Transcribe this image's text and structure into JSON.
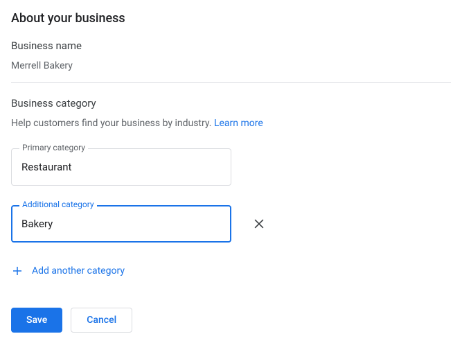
{
  "pageTitle": "About your business",
  "businessName": {
    "label": "Business name",
    "value": "Merrell Bakery"
  },
  "businessCategory": {
    "label": "Business category",
    "helperText": "Help customers find your business by industry. ",
    "learnMore": "Learn more"
  },
  "primaryCategory": {
    "label": "Primary category",
    "value": "Restaurant"
  },
  "additionalCategory": {
    "label": "Additional category",
    "value": "Bakery"
  },
  "addAnother": "Add another category",
  "buttons": {
    "save": "Save",
    "cancel": "Cancel"
  }
}
